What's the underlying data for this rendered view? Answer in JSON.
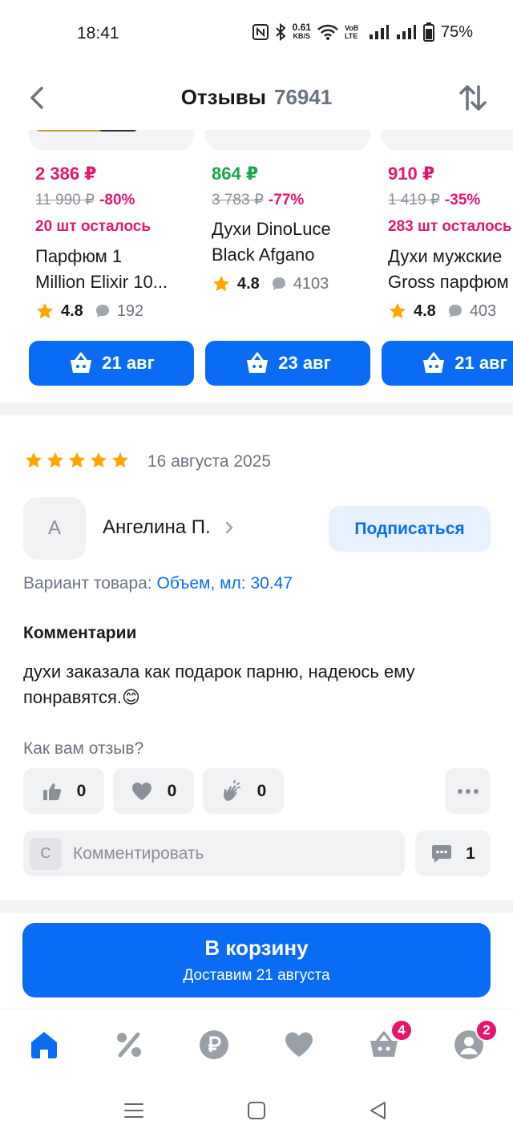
{
  "status_bar": {
    "time": "18:41",
    "speed_value": "0.61",
    "speed_unit": "KB/S",
    "network": "VoB LTE",
    "battery": "75%"
  },
  "header": {
    "title": "Отзывы",
    "count": "76941"
  },
  "products": [
    {
      "price": "2 386 ₽",
      "price_color": "#e6166f",
      "old_price": "11 990 ₽",
      "discount": "-80%",
      "stock": "20 шт осталось",
      "name_lines": [
        "Парфюм 1",
        "Million Elixir 10..."
      ],
      "rating": "4.8",
      "reviews": "192",
      "delivery": "21 авг"
    },
    {
      "price": "864 ₽",
      "price_color": "#1aa64b",
      "old_price": "3 783 ₽",
      "discount": "-77%",
      "stock": "",
      "name_lines": [
        "Духи DinoLuce",
        "Black Afgano"
      ],
      "rating": "4.8",
      "reviews": "4103",
      "delivery": "23 авг"
    },
    {
      "price": "910 ₽",
      "price_color": "#e6166f",
      "old_price": "1 419 ₽",
      "discount": "-35%",
      "stock": "283 шт осталось",
      "name_lines": [
        "Духи мужские",
        "Gross парфюм"
      ],
      "rating": "4.8",
      "reviews": "403",
      "delivery": "21 авг"
    }
  ],
  "review": {
    "stars": 5,
    "date": "16 августа 2025",
    "avatar_letter": "А",
    "author": "Ангелина П.",
    "subscribe": "Подписаться",
    "variant_label": "Вариант товара:",
    "variant_value": "Объем, мл: 30.47",
    "comments_title": "Комментарии",
    "comment": "духи заказала как подарок парню, надеюсь ему понравятся.😊",
    "how_label": "Как вам отзыв?",
    "likes": "0",
    "hearts": "0",
    "claps": "0",
    "comment_avatar": "С",
    "comment_placeholder": "Комментировать",
    "comments_count": "1"
  },
  "cart_button": {
    "title": "В корзину",
    "subtitle": "Доставим 21 августа"
  },
  "tabbar": {
    "cart_badge": "4",
    "profile_badge": "2"
  },
  "colors": {
    "accent": "#0a6cf5",
    "pink": "#e6166f",
    "green": "#1aa64b",
    "star": "#ffa600"
  }
}
